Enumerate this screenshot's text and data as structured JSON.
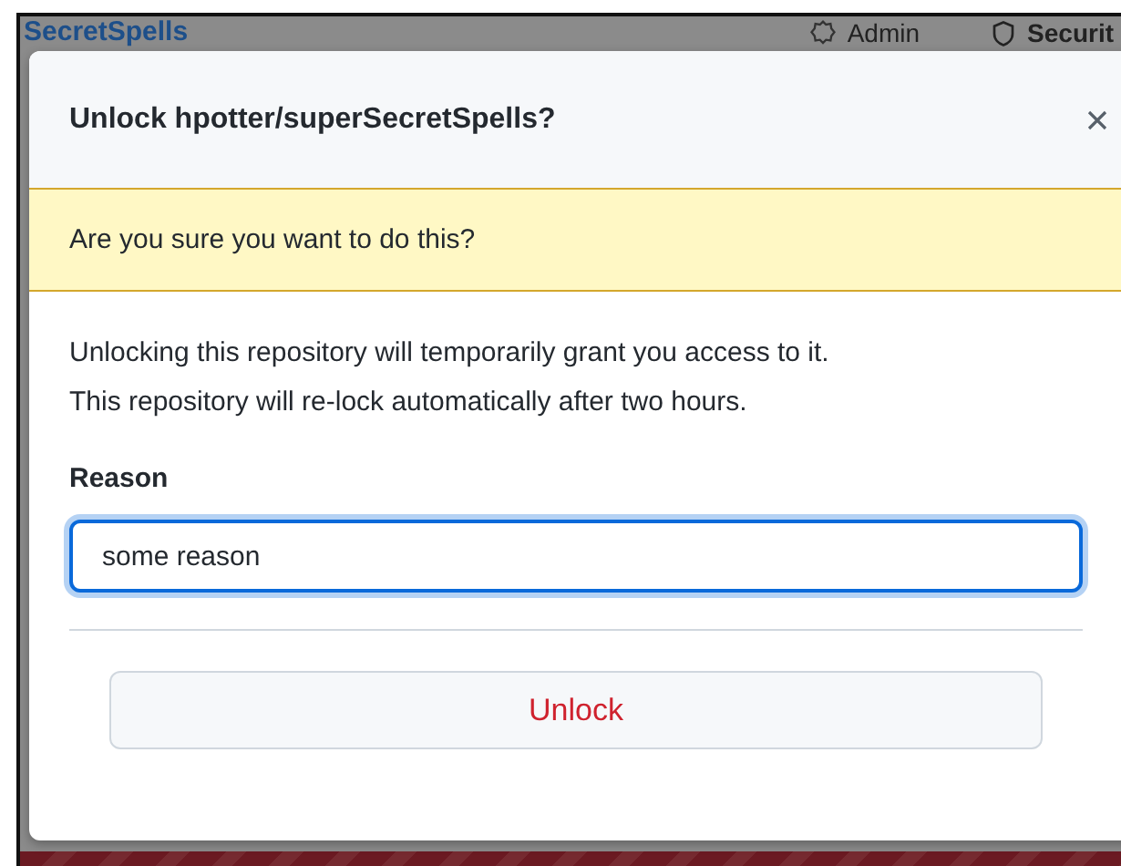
{
  "background_page": {
    "repo_name": "SecretSpells",
    "nav": [
      {
        "kind": "admin",
        "label": "Admin"
      },
      {
        "kind": "security",
        "label": "Securit"
      }
    ]
  },
  "dialog": {
    "title": "Unlock hpotter/superSecretSpells?",
    "warning": "Are you sure you want to do this?",
    "description": [
      "Unlocking this repository will temporarily grant you access to it.",
      "This repository will re-lock automatically after two hours."
    ],
    "field_label": "Reason",
    "reason_value": "some reason",
    "submit_button": "Unlock"
  }
}
